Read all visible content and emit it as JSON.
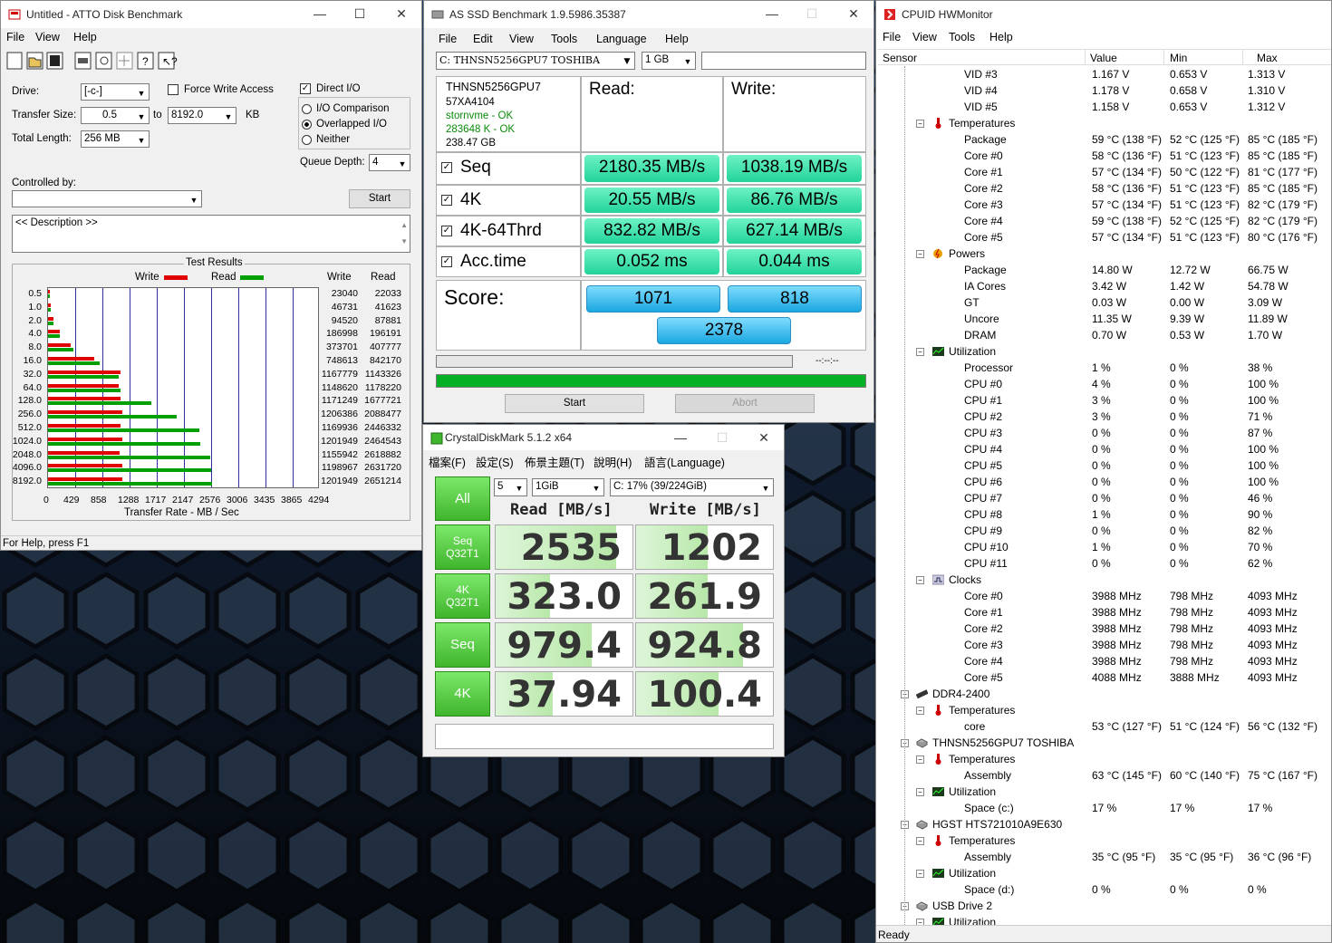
{
  "atto": {
    "title": "Untitled - ATTO Disk Benchmark",
    "menu": [
      "File",
      "View",
      "Help"
    ],
    "drive_label": "Drive:",
    "drive_value": "[-c-]",
    "transfer_size_label": "Transfer Size:",
    "transfer_from": "0.5",
    "to_label": "to",
    "transfer_to": "8192.0",
    "kb_label": "KB",
    "total_length_label": "Total Length:",
    "total_length": "256 MB",
    "force_write": "Force Write Access",
    "direct_io": "Direct I/O",
    "io_comparison": "I/O Comparison",
    "overlapped_io": "Overlapped I/O",
    "neither": "Neither",
    "queue_depth_label": "Queue Depth:",
    "queue_depth": "4",
    "controlled_by": "Controlled by:",
    "start": "Start",
    "description": "<< Description >>",
    "results_title": "Test Results",
    "legend_write": "Write",
    "legend_read": "Read",
    "col_write": "Write",
    "col_read": "Read",
    "xlabel": "Transfer Rate - MB / Sec",
    "status": "For Help, press F1",
    "write_color": "#e00000",
    "read_color": "#00a000"
  },
  "chart_data": {
    "type": "bar",
    "orientation": "horizontal",
    "categories": [
      "0.5",
      "1.0",
      "2.0",
      "4.0",
      "8.0",
      "16.0",
      "32.0",
      "64.0",
      "128.0",
      "256.0",
      "512.0",
      "1024.0",
      "2048.0",
      "4096.0",
      "8192.0"
    ],
    "series": [
      {
        "name": "Write",
        "values": [
          23040,
          46731,
          94520,
          186998,
          373701,
          748613,
          1167779,
          1148620,
          1171249,
          1206386,
          1169936,
          1201949,
          1155942,
          1198967,
          1201949
        ]
      },
      {
        "name": "Read",
        "values": [
          22033,
          41623,
          87881,
          196191,
          407777,
          842170,
          1143326,
          1178220,
          1677721,
          2088477,
          2446332,
          2464543,
          2618882,
          2631720,
          2651214
        ]
      }
    ],
    "xticks": [
      "0",
      "429",
      "858",
      "1288",
      "1717",
      "2147",
      "2576",
      "3006",
      "3435",
      "3865",
      "4294"
    ],
    "xlim": [
      0,
      4294
    ],
    "xlabel": "Transfer Rate - MB / Sec",
    "title": "Test Results"
  },
  "asssd": {
    "title": "AS SSD Benchmark 1.9.5986.35387",
    "menu": [
      "File",
      "Edit",
      "View",
      "Tools",
      "Language",
      "Help"
    ],
    "drive": "C: THNSN5256GPU7 TOSHIBA",
    "size": "1 GB",
    "info": [
      "THNSN5256GPU7",
      "57XA4104",
      "stornvme - OK",
      "283648 K - OK",
      "238.47 GB"
    ],
    "read_header": "Read:",
    "write_header": "Write:",
    "rows": [
      {
        "label": "Seq",
        "read": "2180.35 MB/s",
        "write": "1038.19 MB/s"
      },
      {
        "label": "4K",
        "read": "20.55 MB/s",
        "write": "86.76 MB/s"
      },
      {
        "label": "4K-64Thrd",
        "read": "832.82 MB/s",
        "write": "627.14 MB/s"
      },
      {
        "label": "Acc.time",
        "read": "0.052 ms",
        "write": "0.044 ms"
      }
    ],
    "score_label": "Score:",
    "score_read": "1071",
    "score_write": "818",
    "score_total": "2378",
    "time": "--:--:--",
    "start": "Start",
    "abort": "Abort",
    "progress": 1.0
  },
  "cdm": {
    "title": "CrystalDiskMark 5.1.2 x64",
    "menu": [
      "檔案(F)",
      "設定(S)",
      "佈景主題(T)",
      "說明(H)",
      "語言(Language)"
    ],
    "all": "All",
    "count": "5",
    "size": "1GiB",
    "drive": "C: 17% (39/224GiB)",
    "read_header": "Read [MB/s]",
    "write_header": "Write [MB/s]",
    "rows": [
      {
        "l1": "Seq",
        "l2": "Q32T1",
        "read": "2535",
        "write": "1202",
        "rf": 0.88,
        "wf": 0.52
      },
      {
        "l1": "4K",
        "l2": "Q32T1",
        "read": "323.0",
        "write": "261.9",
        "rf": 0.4,
        "wf": 0.52
      },
      {
        "l1": "Seq",
        "l2": "",
        "read": "979.4",
        "write": "924.8",
        "rf": 0.7,
        "wf": 0.78
      },
      {
        "l1": "4K",
        "l2": "",
        "read": "37.94",
        "write": "100.4",
        "rf": 0.42,
        "wf": 0.6
      }
    ]
  },
  "hwm": {
    "title": "CPUID HWMonitor",
    "menu": [
      "File",
      "View",
      "Tools",
      "Help"
    ],
    "headers": [
      "Sensor",
      "Value",
      "Min",
      "Max"
    ],
    "status": "Ready",
    "rows": [
      {
        "lvl": 3,
        "n": "VID #3",
        "v": "1.167 V",
        "mn": "0.653 V",
        "mx": "1.313 V"
      },
      {
        "lvl": 3,
        "n": "VID #4",
        "v": "1.178 V",
        "mn": "0.658 V",
        "mx": "1.310 V"
      },
      {
        "lvl": 3,
        "n": "VID #5",
        "v": "1.158 V",
        "mn": "0.653 V",
        "mx": "1.312 V"
      },
      {
        "lvl": 2,
        "n": "Temperatures",
        "ic": "temp"
      },
      {
        "lvl": 3,
        "n": "Package",
        "v": "59 °C  (138 °F)",
        "mn": "52 °C  (125 °F)",
        "mx": "85 °C  (185 °F)"
      },
      {
        "lvl": 3,
        "n": "Core #0",
        "v": "58 °C  (136 °F)",
        "mn": "51 °C  (123 °F)",
        "mx": "85 °C  (185 °F)"
      },
      {
        "lvl": 3,
        "n": "Core #1",
        "v": "57 °C  (134 °F)",
        "mn": "50 °C  (122 °F)",
        "mx": "81 °C  (177 °F)"
      },
      {
        "lvl": 3,
        "n": "Core #2",
        "v": "58 °C  (136 °F)",
        "mn": "51 °C  (123 °F)",
        "mx": "85 °C  (185 °F)"
      },
      {
        "lvl": 3,
        "n": "Core #3",
        "v": "57 °C  (134 °F)",
        "mn": "51 °C  (123 °F)",
        "mx": "82 °C  (179 °F)"
      },
      {
        "lvl": 3,
        "n": "Core #4",
        "v": "59 °C  (138 °F)",
        "mn": "52 °C  (125 °F)",
        "mx": "82 °C  (179 °F)"
      },
      {
        "lvl": 3,
        "n": "Core #5",
        "v": "57 °C  (134 °F)",
        "mn": "51 °C  (123 °F)",
        "mx": "80 °C  (176 °F)"
      },
      {
        "lvl": 2,
        "n": "Powers",
        "ic": "power"
      },
      {
        "lvl": 3,
        "n": "Package",
        "v": "14.80 W",
        "mn": "12.72 W",
        "mx": "66.75 W"
      },
      {
        "lvl": 3,
        "n": "IA Cores",
        "v": "3.42 W",
        "mn": "1.42 W",
        "mx": "54.78 W"
      },
      {
        "lvl": 3,
        "n": "GT",
        "v": "0.03 W",
        "mn": "0.00 W",
        "mx": "3.09 W"
      },
      {
        "lvl": 3,
        "n": "Uncore",
        "v": "11.35 W",
        "mn": "9.39 W",
        "mx": "11.89 W"
      },
      {
        "lvl": 3,
        "n": "DRAM",
        "v": "0.70 W",
        "mn": "0.53 W",
        "mx": "1.70 W"
      },
      {
        "lvl": 2,
        "n": "Utilization",
        "ic": "util"
      },
      {
        "lvl": 3,
        "n": "Processor",
        "v": "1 %",
        "mn": "0 %",
        "mx": "38 %"
      },
      {
        "lvl": 3,
        "n": "CPU #0",
        "v": "4 %",
        "mn": "0 %",
        "mx": "100 %"
      },
      {
        "lvl": 3,
        "n": "CPU #1",
        "v": "3 %",
        "mn": "0 %",
        "mx": "100 %"
      },
      {
        "lvl": 3,
        "n": "CPU #2",
        "v": "3 %",
        "mn": "0 %",
        "mx": "71 %"
      },
      {
        "lvl": 3,
        "n": "CPU #3",
        "v": "0 %",
        "mn": "0 %",
        "mx": "87 %"
      },
      {
        "lvl": 3,
        "n": "CPU #4",
        "v": "0 %",
        "mn": "0 %",
        "mx": "100 %"
      },
      {
        "lvl": 3,
        "n": "CPU #5",
        "v": "0 %",
        "mn": "0 %",
        "mx": "100 %"
      },
      {
        "lvl": 3,
        "n": "CPU #6",
        "v": "0 %",
        "mn": "0 %",
        "mx": "100 %"
      },
      {
        "lvl": 3,
        "n": "CPU #7",
        "v": "0 %",
        "mn": "0 %",
        "mx": "46 %"
      },
      {
        "lvl": 3,
        "n": "CPU #8",
        "v": "1 %",
        "mn": "0 %",
        "mx": "90 %"
      },
      {
        "lvl": 3,
        "n": "CPU #9",
        "v": "0 %",
        "mn": "0 %",
        "mx": "82 %"
      },
      {
        "lvl": 3,
        "n": "CPU #10",
        "v": "1 %",
        "mn": "0 %",
        "mx": "70 %"
      },
      {
        "lvl": 3,
        "n": "CPU #11",
        "v": "0 %",
        "mn": "0 %",
        "mx": "62 %"
      },
      {
        "lvl": 2,
        "n": "Clocks",
        "ic": "clock"
      },
      {
        "lvl": 3,
        "n": "Core #0",
        "v": "3988 MHz",
        "mn": "798 MHz",
        "mx": "4093 MHz"
      },
      {
        "lvl": 3,
        "n": "Core #1",
        "v": "3988 MHz",
        "mn": "798 MHz",
        "mx": "4093 MHz"
      },
      {
        "lvl": 3,
        "n": "Core #2",
        "v": "3988 MHz",
        "mn": "798 MHz",
        "mx": "4093 MHz"
      },
      {
        "lvl": 3,
        "n": "Core #3",
        "v": "3988 MHz",
        "mn": "798 MHz",
        "mx": "4093 MHz"
      },
      {
        "lvl": 3,
        "n": "Core #4",
        "v": "3988 MHz",
        "mn": "798 MHz",
        "mx": "4093 MHz"
      },
      {
        "lvl": 3,
        "n": "Core #5",
        "v": "4088 MHz",
        "mn": "3888 MHz",
        "mx": "4093 MHz"
      },
      {
        "lvl": 1,
        "n": "DDR4-2400",
        "ic": "ram"
      },
      {
        "lvl": 2,
        "n": "Temperatures",
        "ic": "temp"
      },
      {
        "lvl": 3,
        "n": "core",
        "v": "53 °C  (127 °F)",
        "mn": "51 °C  (124 °F)",
        "mx": "56 °C  (132 °F)"
      },
      {
        "lvl": 1,
        "n": "THNSN5256GPU7 TOSHIBA",
        "ic": "disk"
      },
      {
        "lvl": 2,
        "n": "Temperatures",
        "ic": "temp"
      },
      {
        "lvl": 3,
        "n": "Assembly",
        "v": "63 °C  (145 °F)",
        "mn": "60 °C  (140 °F)",
        "mx": "75 °C  (167 °F)"
      },
      {
        "lvl": 2,
        "n": "Utilization",
        "ic": "util"
      },
      {
        "lvl": 3,
        "n": "Space (c:)",
        "v": "17 %",
        "mn": "17 %",
        "mx": "17 %"
      },
      {
        "lvl": 1,
        "n": "HGST HTS721010A9E630",
        "ic": "disk"
      },
      {
        "lvl": 2,
        "n": "Temperatures",
        "ic": "temp"
      },
      {
        "lvl": 3,
        "n": "Assembly",
        "v": "35 °C  (95 °F)",
        "mn": "35 °C  (95 °F)",
        "mx": "36 °C  (96 °F)"
      },
      {
        "lvl": 2,
        "n": "Utilization",
        "ic": "util"
      },
      {
        "lvl": 3,
        "n": "Space (d:)",
        "v": "0 %",
        "mn": "0 %",
        "mx": "0 %"
      },
      {
        "lvl": 1,
        "n": "USB Drive 2",
        "ic": "disk"
      },
      {
        "lvl": 2,
        "n": "Utilization",
        "ic": "util"
      }
    ]
  }
}
